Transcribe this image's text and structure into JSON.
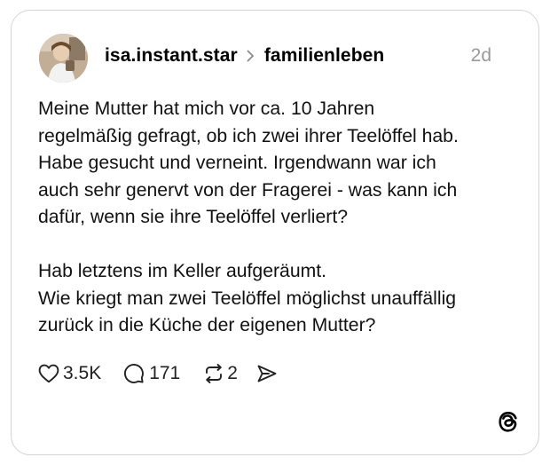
{
  "post": {
    "username": "isa.instant.star",
    "community": "familienleben",
    "time": "2d",
    "paragraph1_lines": [
      "Meine Mutter hat mich vor ca. 10 Jahren",
      "regelmäßig gefragt, ob ich zwei ihrer Teelöffel hab.",
      "Habe gesucht und verneint. Irgendwann war ich",
      "auch sehr genervt von der Fragerei - was kann ich",
      "dafür, wenn sie ihre Teelöffel verliert?"
    ],
    "paragraph2_lines": [
      "Hab letztens im Keller aufgeräumt.",
      "Wie kriegt man zwei Teelöffel möglichst unauffällig",
      "zurück in die Küche der eigenen Mutter?"
    ]
  },
  "actions": {
    "likes": "3.5K",
    "comments": "171",
    "reposts": "2"
  },
  "icons": {
    "like": "heart-icon",
    "comment": "comment-bubble-icon",
    "repost": "repost-icon",
    "share": "send-icon",
    "chevron": "chevron-right-icon",
    "brand": "threads-logo-icon"
  }
}
